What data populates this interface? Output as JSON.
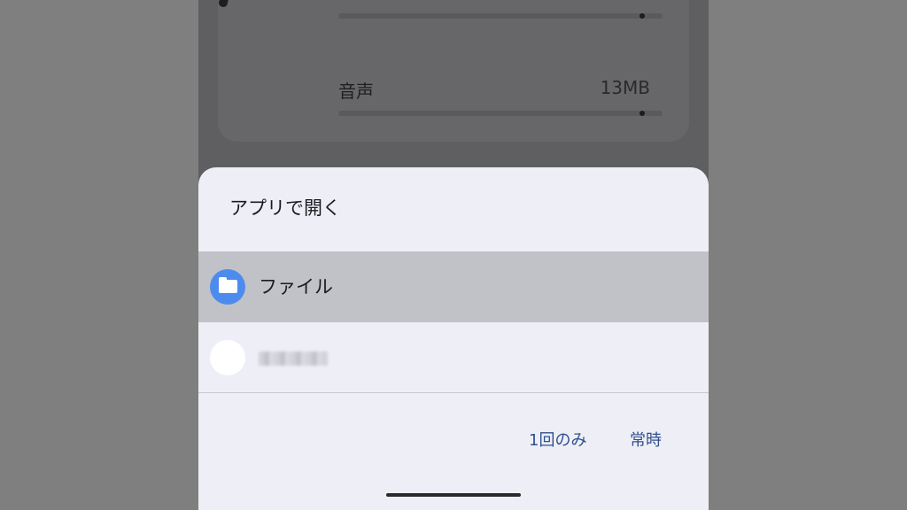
{
  "background_list": {
    "rows": [
      {
        "label": "",
        "size": ""
      },
      {
        "label": "音声",
        "size": "13MB",
        "icon": "music-note-icon"
      }
    ]
  },
  "dialog": {
    "title": "アプリで開く",
    "apps": [
      {
        "label": "ファイル",
        "icon": "folder-icon",
        "selected": true
      },
      {
        "label": "",
        "icon": "app-icon",
        "selected": false
      }
    ],
    "actions": {
      "once": "1回のみ",
      "always": "常時"
    }
  },
  "colors": {
    "accent": "#2f4f8f",
    "files_icon": "#4d8cee",
    "selected_row": "#c1c2c7",
    "sheet": "#eeeff6"
  }
}
